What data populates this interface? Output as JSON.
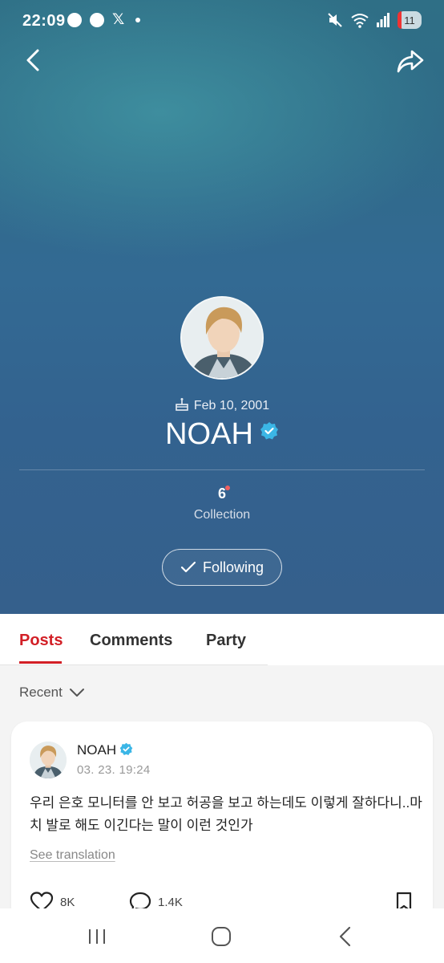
{
  "status_bar": {
    "time": "22:09",
    "battery": "11",
    "left_icons": [
      "line-icon",
      "chat-icon",
      "x-icon",
      "dot-icon"
    ],
    "right_icons": [
      "mute-icon",
      "wifi-icon",
      "signal-icon",
      "battery-icon"
    ]
  },
  "profile": {
    "birthday": "Feb 10, 2001",
    "name": "NOAH",
    "verified": true,
    "collection_count": "6",
    "collection_label": "Collection",
    "follow_label": "Following"
  },
  "tabs": [
    {
      "label": "Posts",
      "active": true
    },
    {
      "label": "Comments",
      "active": false
    },
    {
      "label": "Party",
      "active": false
    }
  ],
  "sort": {
    "label": "Recent"
  },
  "post": {
    "author": "NOAH",
    "timestamp": "03. 23. 19:24",
    "text": "우리 은호 모니터를 안 보고 허공을 보고 하는데도 이렇게 잘하다니..마치 발로 해도 이긴다는 말이 이런 것인가",
    "see_translation": "See translation",
    "likes": "8K",
    "comments": "1.4K"
  },
  "colors": {
    "accent": "#d21f26",
    "verified": "#3bb6e6",
    "hero_top": "#2f6f86",
    "hero_bottom": "#35608c"
  }
}
